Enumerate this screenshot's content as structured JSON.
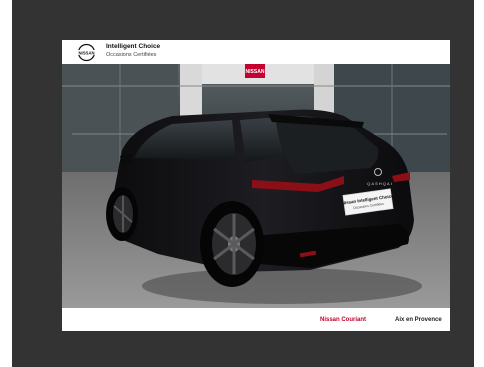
{
  "header": {
    "logo_text": "NISSAN",
    "title": "Intelligent Choice",
    "subtitle": "Occasions Certifiées"
  },
  "photo": {
    "subject": "black-suv-rear-three-quarter",
    "store_sign": "NISSAN",
    "tailgate_badge": "QASHQAI",
    "plate_line1": "Nissan Intelligent Choice",
    "plate_line2": "Occasions Certifiées"
  },
  "footer": {
    "dealer": "Nissan Couriant",
    "location": "Aix en Provence"
  },
  "colors": {
    "frame": "#333333",
    "brand_red": "#c3002f",
    "car_body": "#141416"
  }
}
